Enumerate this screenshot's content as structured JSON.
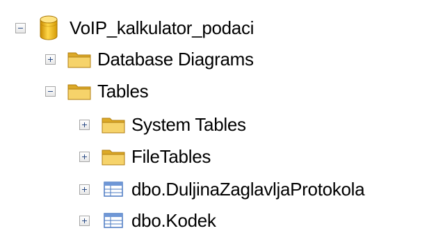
{
  "tree": {
    "database": {
      "label": "VoIP_kalkulator_podaci",
      "expanded": true,
      "icon": "database-cylinder-icon"
    },
    "nodes": [
      {
        "label": "Database Diagrams",
        "icon": "folder-icon",
        "expanded": false
      },
      {
        "label": "Tables",
        "icon": "folder-icon",
        "expanded": true
      },
      {
        "label": "System Tables",
        "icon": "folder-icon",
        "expanded": false
      },
      {
        "label": "FileTables",
        "icon": "folder-icon",
        "expanded": false
      },
      {
        "label": "dbo.DuljinaZaglavljaProtokola",
        "icon": "table-icon",
        "expanded": false
      },
      {
        "label": "dbo.Kodek",
        "icon": "table-icon",
        "expanded": false
      }
    ]
  },
  "colors": {
    "database_gold": "#e8b417",
    "folder_yellow": "#f3cd5c",
    "table_blue": "#4a78c2",
    "expander_sign": "#2b4c86"
  }
}
